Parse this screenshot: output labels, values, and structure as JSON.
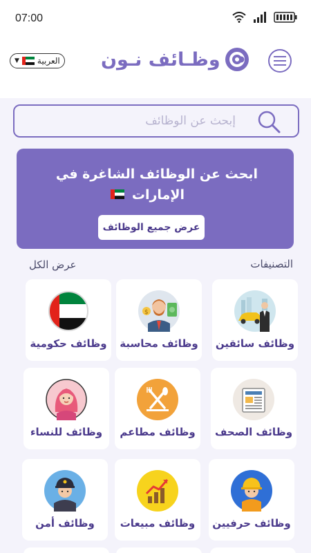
{
  "status_bar": {
    "time": "07:00"
  },
  "header": {
    "app_name": "وظـائف نـون",
    "language": "العربية"
  },
  "search": {
    "placeholder": "إبحث عن الوظائف"
  },
  "banner": {
    "title_line1": "ابحث عن الوظائف الشاغرة في",
    "title_line2": "الإمارات",
    "button_label": "عرض جميع الوظائف"
  },
  "categories_section": {
    "title": "التصنيفات",
    "view_all": "عرض الكل",
    "items": [
      {
        "label": "وظائف سائقين",
        "icon": "driver-car-icon"
      },
      {
        "label": "وظائف محاسبة",
        "icon": "accountant-icon"
      },
      {
        "label": "وظائف حكومية",
        "icon": "uae-flag-icon"
      },
      {
        "label": "وظائف الصحف",
        "icon": "newspaper-icon"
      },
      {
        "label": "وظائف مطاعم",
        "icon": "restaurant-icon"
      },
      {
        "label": "وظائف للنساء",
        "icon": "woman-icon"
      },
      {
        "label": "وظائف حرفيين",
        "icon": "worker-icon"
      },
      {
        "label": "وظائف مبيعات",
        "icon": "sales-chart-icon"
      },
      {
        "label": "وظائف أمن",
        "icon": "security-guard-icon"
      }
    ]
  },
  "colors": {
    "brand": "#7b6cc0",
    "brand_dark": "#4b3a8c",
    "background": "#f4f3fb"
  }
}
